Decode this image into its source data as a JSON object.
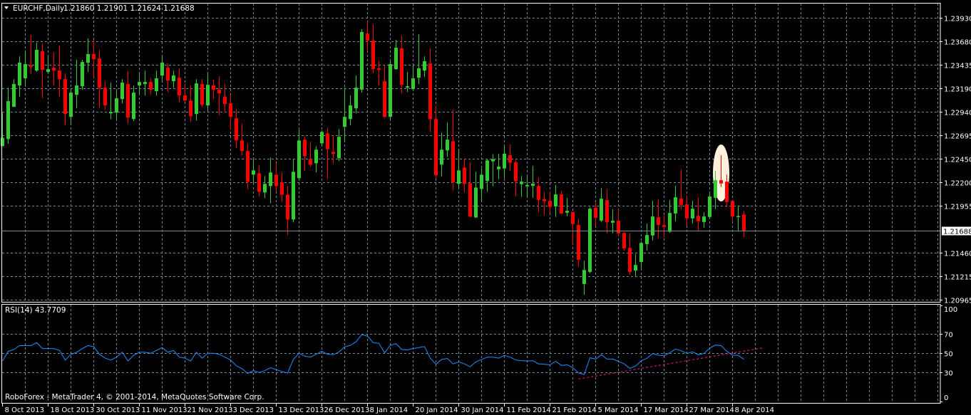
{
  "header": {
    "symbol_timeframe": "EURCHF,Daily",
    "ohlc_text": "1.21860 1.21901 1.21624 1.21688"
  },
  "rsi_panel": {
    "label": "RSI(14) 43.7709"
  },
  "footer": {
    "copyright": "RoboForex - MetaTrader 4, © 2001-2014, MetaQuotes Software Corp."
  },
  "colors": {
    "background": "#000000",
    "grid": "#778899",
    "bull": "#32CD32",
    "bear": "#FF0000",
    "rsi_line": "#1E90FF",
    "trendline": "#FF1493",
    "highlight": "#FFF0DC",
    "border": "#FFFFFF"
  },
  "chart_data": [
    {
      "type": "candlestick",
      "title": "EURCHF,Daily",
      "symbol": "EURCHF",
      "timeframe": "Daily",
      "ylim": [
        1.20965,
        1.2393
      ],
      "grid": true,
      "current_price": "1.21688",
      "price_labels": [
        "1.23930",
        "1.23680",
        "1.23435",
        "1.23190",
        "1.22940",
        "1.22695",
        "1.22450",
        "1.22200",
        "1.21955",
        "1.21460",
        "1.21215",
        "1.20965"
      ],
      "x_labels": [
        {
          "bar": 1,
          "text": "8 Oct 2013"
        },
        {
          "bar": 9,
          "text": "18 Oct 2013"
        },
        {
          "bar": 17,
          "text": "30 Oct 2013"
        },
        {
          "bar": 25,
          "text": "11 Nov 2013"
        },
        {
          "bar": 33,
          "text": "21 Nov 2013"
        },
        {
          "bar": 41,
          "text": "3 Dec 2013"
        },
        {
          "bar": 49,
          "text": "13 Dec 2013"
        },
        {
          "bar": 57,
          "text": "26 Dec 2013"
        },
        {
          "bar": 65,
          "text": "8 Jan 2014"
        },
        {
          "bar": 73,
          "text": "20 Jan 2014"
        },
        {
          "bar": 81,
          "text": "30 Jan 2014"
        },
        {
          "bar": 89,
          "text": "11 Feb 2014"
        },
        {
          "bar": 97,
          "text": "21 Feb 2014"
        },
        {
          "bar": 105,
          "text": "5 Mar 2014"
        },
        {
          "bar": 113,
          "text": "17 Mar 2014"
        },
        {
          "bar": 121,
          "text": "27 Mar 2014"
        },
        {
          "bar": 129,
          "text": "8 Apr 2014"
        }
      ],
      "highlight_bar": 127,
      "ohlc_columns": [
        "open",
        "high",
        "low",
        "close"
      ],
      "candles": [
        [
          1.2258,
          1.2293,
          1.2258,
          1.22668
        ],
        [
          1.22655,
          1.23193,
          1.22605,
          1.23053
        ],
        [
          1.22993,
          1.23285,
          1.22993,
          1.23233
        ],
        [
          1.23218,
          1.23525,
          1.23098,
          1.23458
        ],
        [
          1.23293,
          1.23578,
          1.2321,
          1.23443
        ],
        [
          1.2343,
          1.2375,
          1.2334,
          1.23415
        ],
        [
          1.23375,
          1.23668,
          1.2336,
          1.23593
        ],
        [
          1.23578,
          1.2366,
          1.2309,
          1.23383
        ],
        [
          1.2336,
          1.23518,
          1.23348,
          1.2339
        ],
        [
          1.23405,
          1.2357,
          1.23218,
          1.23375
        ],
        [
          1.23375,
          1.23638,
          1.23098,
          1.23285
        ],
        [
          1.23285,
          1.23345,
          1.22805,
          1.22918
        ],
        [
          1.22888,
          1.23188,
          1.2282,
          1.23143
        ],
        [
          1.2312,
          1.23488,
          1.22978,
          1.23218
        ],
        [
          1.2321,
          1.23488,
          1.23173,
          1.23465
        ],
        [
          1.23458,
          1.23713,
          1.2336,
          1.23548
        ],
        [
          1.23548,
          1.23698,
          1.233,
          1.23495
        ],
        [
          1.23503,
          1.23593,
          1.22985,
          1.23195
        ],
        [
          1.23195,
          1.23263,
          1.22963,
          1.23008
        ],
        [
          1.22925,
          1.23248,
          1.22865,
          1.2294
        ],
        [
          1.22933,
          1.23158,
          1.22858,
          1.23083
        ],
        [
          1.23075,
          1.23285,
          1.2303,
          1.23248
        ],
        [
          1.23233,
          1.23368,
          1.22813,
          1.2288
        ],
        [
          1.22865,
          1.23218,
          1.22843,
          1.23143
        ],
        [
          1.23218,
          1.23338,
          1.23135,
          1.23255
        ],
        [
          1.23233,
          1.23375,
          1.23113,
          1.23255
        ],
        [
          1.23255,
          1.23293,
          1.2312,
          1.23173
        ],
        [
          1.23158,
          1.23375,
          1.23113,
          1.23293
        ],
        [
          1.23323,
          1.23518,
          1.23263,
          1.23458
        ],
        [
          1.23405,
          1.2345,
          1.2315,
          1.2327
        ],
        [
          1.23263,
          1.23375,
          1.23195,
          1.23323
        ],
        [
          1.233,
          1.23398,
          1.23045,
          1.23113
        ],
        [
          1.23113,
          1.23233,
          1.23045,
          1.2306
        ],
        [
          1.2306,
          1.23218,
          1.22835,
          1.22895
        ],
        [
          1.22918,
          1.23285,
          1.2285,
          1.2324
        ],
        [
          1.23233,
          1.23285,
          1.22993,
          1.23015
        ],
        [
          1.23008,
          1.23338,
          1.22955,
          1.23225
        ],
        [
          1.23218,
          1.23278,
          1.23075,
          1.23173
        ],
        [
          1.23173,
          1.23315,
          1.2291,
          1.23135
        ],
        [
          1.23098,
          1.23233,
          1.22933,
          1.23023
        ],
        [
          1.2303,
          1.2312,
          1.2276,
          1.22888
        ],
        [
          1.22873,
          1.2297,
          1.22558,
          1.2264
        ],
        [
          1.2264,
          1.22813,
          1.22483,
          1.22528
        ],
        [
          1.22528,
          1.2261,
          1.2213,
          1.22205
        ],
        [
          1.2228,
          1.22438,
          1.22193,
          1.22325
        ],
        [
          1.22295,
          1.22378,
          1.22048,
          1.221
        ],
        [
          1.22093,
          1.22265,
          1.22033,
          1.22183
        ],
        [
          1.2216,
          1.2246,
          1.2198,
          1.22303
        ],
        [
          1.2228,
          1.224,
          1.221,
          1.2216
        ],
        [
          1.22198,
          1.2231,
          1.21995,
          1.2207
        ],
        [
          1.2207,
          1.2216,
          1.21643,
          1.21808
        ],
        [
          1.21808,
          1.22438,
          1.21778,
          1.2231
        ],
        [
          1.22243,
          1.22753,
          1.22235,
          1.2264
        ],
        [
          1.22648,
          1.22685,
          1.22318,
          1.22475
        ],
        [
          1.22445,
          1.22625,
          1.22363,
          1.22385
        ],
        [
          1.224,
          1.2258,
          1.22303,
          1.22543
        ],
        [
          1.2261,
          1.22745,
          1.2258,
          1.2273
        ],
        [
          1.22715,
          1.22775,
          1.22235,
          1.2255
        ],
        [
          1.2252,
          1.22693,
          1.22393,
          1.22498
        ],
        [
          1.22453,
          1.2276,
          1.22423,
          1.22678
        ],
        [
          1.22783,
          1.23195,
          1.2264,
          1.22888
        ],
        [
          1.22865,
          1.23113,
          1.22798,
          1.23008
        ],
        [
          1.22978,
          1.23323,
          1.22925,
          1.23195
        ],
        [
          1.23173,
          1.2381,
          1.23143,
          1.2378
        ],
        [
          1.23765,
          1.2389,
          1.23578,
          1.2369
        ],
        [
          1.2369,
          1.23863,
          1.23345,
          1.2339
        ],
        [
          1.23398,
          1.23473,
          1.23218,
          1.23383
        ],
        [
          1.23263,
          1.23428,
          1.2288,
          1.22888
        ],
        [
          1.22888,
          1.23473,
          1.22865,
          1.23443
        ],
        [
          1.2339,
          1.23698,
          1.23383,
          1.23615
        ],
        [
          1.23608,
          1.23743,
          1.23135,
          1.23225
        ],
        [
          1.23195,
          1.2336,
          1.2315,
          1.2321
        ],
        [
          1.2318,
          1.23428,
          1.2318,
          1.23293
        ],
        [
          1.233,
          1.23758,
          1.23233,
          1.23398
        ],
        [
          1.23375,
          1.23525,
          1.23308,
          1.23473
        ],
        [
          1.2345,
          1.23608,
          1.2273,
          1.22865
        ],
        [
          1.22865,
          1.23,
          1.22243,
          1.22273
        ],
        [
          1.22385,
          1.22723,
          1.22258,
          1.22543
        ],
        [
          1.22535,
          1.22828,
          1.22468,
          1.22648
        ],
        [
          1.22633,
          1.22963,
          1.22115,
          1.22198
        ],
        [
          1.22183,
          1.22535,
          1.22145,
          1.22325
        ],
        [
          1.22355,
          1.22445,
          1.22093,
          1.22183
        ],
        [
          1.2219,
          1.22408,
          1.2183,
          1.21838
        ],
        [
          1.2183,
          1.2231,
          1.21823,
          1.22145
        ],
        [
          1.2213,
          1.22348,
          1.2201,
          1.2228
        ],
        [
          1.22213,
          1.22445,
          1.221,
          1.2243
        ],
        [
          1.2242,
          1.22495,
          1.22157,
          1.22442
        ],
        [
          1.22337,
          1.225,
          1.22232,
          1.22365
        ],
        [
          1.22345,
          1.22575,
          1.22242,
          1.225
        ],
        [
          1.22485,
          1.22597,
          1.22322,
          1.22405
        ],
        [
          1.2241,
          1.22432,
          1.22052,
          1.2221
        ],
        [
          1.2218,
          1.22267,
          1.22045,
          1.22207
        ],
        [
          1.22157,
          1.2226,
          1.22042,
          1.22172
        ],
        [
          1.22162,
          1.22372,
          1.22037,
          1.22185
        ],
        [
          1.22162,
          1.22252,
          1.21887,
          1.22015
        ],
        [
          1.22022,
          1.22095,
          1.2185,
          1.22
        ],
        [
          1.22005,
          1.22105,
          1.21872,
          1.2194
        ],
        [
          1.21947,
          1.2217,
          1.21835,
          1.22072
        ],
        [
          1.22072,
          1.2211,
          1.21865,
          1.21872
        ],
        [
          1.2188,
          1.22035,
          1.21842,
          1.219
        ],
        [
          1.21887,
          1.2189,
          1.2155,
          1.2176
        ],
        [
          1.2175,
          1.21817,
          1.2131,
          1.21385
        ],
        [
          1.2113,
          1.21375,
          1.21017,
          1.21277
        ],
        [
          1.21257,
          1.21937,
          1.21242,
          1.21922
        ],
        [
          1.2193,
          1.2199,
          1.21745,
          1.21827
        ],
        [
          1.21797,
          1.2214,
          1.21782,
          1.22027
        ],
        [
          1.22012,
          1.22132,
          1.21662,
          1.21782
        ],
        [
          1.21775,
          1.21915,
          1.21662,
          1.21795
        ],
        [
          1.21795,
          1.21915,
          1.21632,
          1.21662
        ],
        [
          1.21667,
          1.21675,
          1.21482,
          1.21505
        ],
        [
          1.2151,
          1.21667,
          1.21227,
          1.21257
        ],
        [
          1.21272,
          1.21442,
          1.21205,
          1.2133
        ],
        [
          1.21362,
          1.21577,
          1.21295,
          1.21562
        ],
        [
          1.2155,
          1.21765,
          1.21482,
          1.21645
        ],
        [
          1.2164,
          1.22005,
          1.21587,
          1.2184
        ],
        [
          1.21832,
          1.2202,
          1.2161,
          1.21752
        ],
        [
          1.2175,
          1.2185,
          1.21625,
          1.2173
        ],
        [
          1.2168,
          1.22012,
          1.2167,
          1.21877
        ],
        [
          1.21872,
          1.22162,
          1.2179,
          1.22042
        ],
        [
          1.22027,
          1.22335,
          1.21917,
          1.21962
        ],
        [
          1.21967,
          1.2205,
          1.21745,
          1.2182
        ],
        [
          1.2182,
          1.22005,
          1.21767,
          1.21922
        ],
        [
          1.21847,
          1.22042,
          1.21692,
          1.2179
        ],
        [
          1.21782,
          1.21885,
          1.21722,
          1.2184
        ],
        [
          1.21835,
          1.2208,
          1.2182,
          1.2205
        ],
        [
          1.22037,
          1.2232,
          1.21917,
          1.22222
        ],
        [
          1.22222,
          1.22485,
          1.2215,
          1.22187
        ],
        [
          1.22207,
          1.22282,
          1.2194,
          1.21992
        ],
        [
          1.22005,
          1.2201,
          1.2179,
          1.21842
        ],
        [
          1.2184,
          1.21952,
          1.21692,
          1.21845
        ],
        [
          1.2186,
          1.21901,
          1.21624,
          1.21688
        ]
      ]
    },
    {
      "type": "line",
      "title": "RSI(14)",
      "ylim": [
        0,
        100
      ],
      "levels": [
        "100",
        "70",
        "50",
        "30",
        "0"
      ],
      "grid": true,
      "values": [
        42,
        52,
        54,
        58,
        58,
        58,
        61,
        55,
        55,
        55,
        53,
        43,
        49,
        51,
        55,
        58,
        57,
        49,
        45,
        43,
        46,
        51,
        42,
        48,
        51,
        51,
        50,
        53,
        56,
        51,
        53,
        46,
        45,
        42,
        51,
        45,
        50,
        50,
        49,
        46,
        43,
        37,
        34,
        29,
        32,
        30,
        32,
        35,
        33,
        31,
        29.5,
        43.6,
        50,
        47,
        46,
        49,
        52,
        49,
        48.5,
        51.5,
        56.7,
        58.4,
        62,
        69.5,
        67.8,
        61,
        60.4,
        50.5,
        58.4,
        60,
        54,
        53.5,
        55,
        56,
        57,
        45,
        38.6,
        43.6,
        44.6,
        39,
        41,
        39,
        36,
        41,
        43.6,
        46,
        46,
        45,
        47.8,
        46,
        43,
        42.3,
        42,
        42.3,
        39,
        38.6,
        38,
        41.6,
        37.4,
        38,
        35,
        29.5,
        28,
        45.3,
        44,
        48.5,
        44,
        44,
        41.6,
        39,
        34.4,
        36.7,
        42.3,
        44.8,
        49.8,
        48,
        47.3,
        50.5,
        54.4,
        52.7,
        49.8,
        51.5,
        48.5,
        49.8,
        55.4,
        58.6,
        58,
        52,
        48,
        47.8,
        43.77
      ],
      "trendline": {
        "from": {
          "bar": 102,
          "value": 23.3
        },
        "to": {
          "bar": 134.6,
          "value": 55.9
        }
      }
    }
  ]
}
